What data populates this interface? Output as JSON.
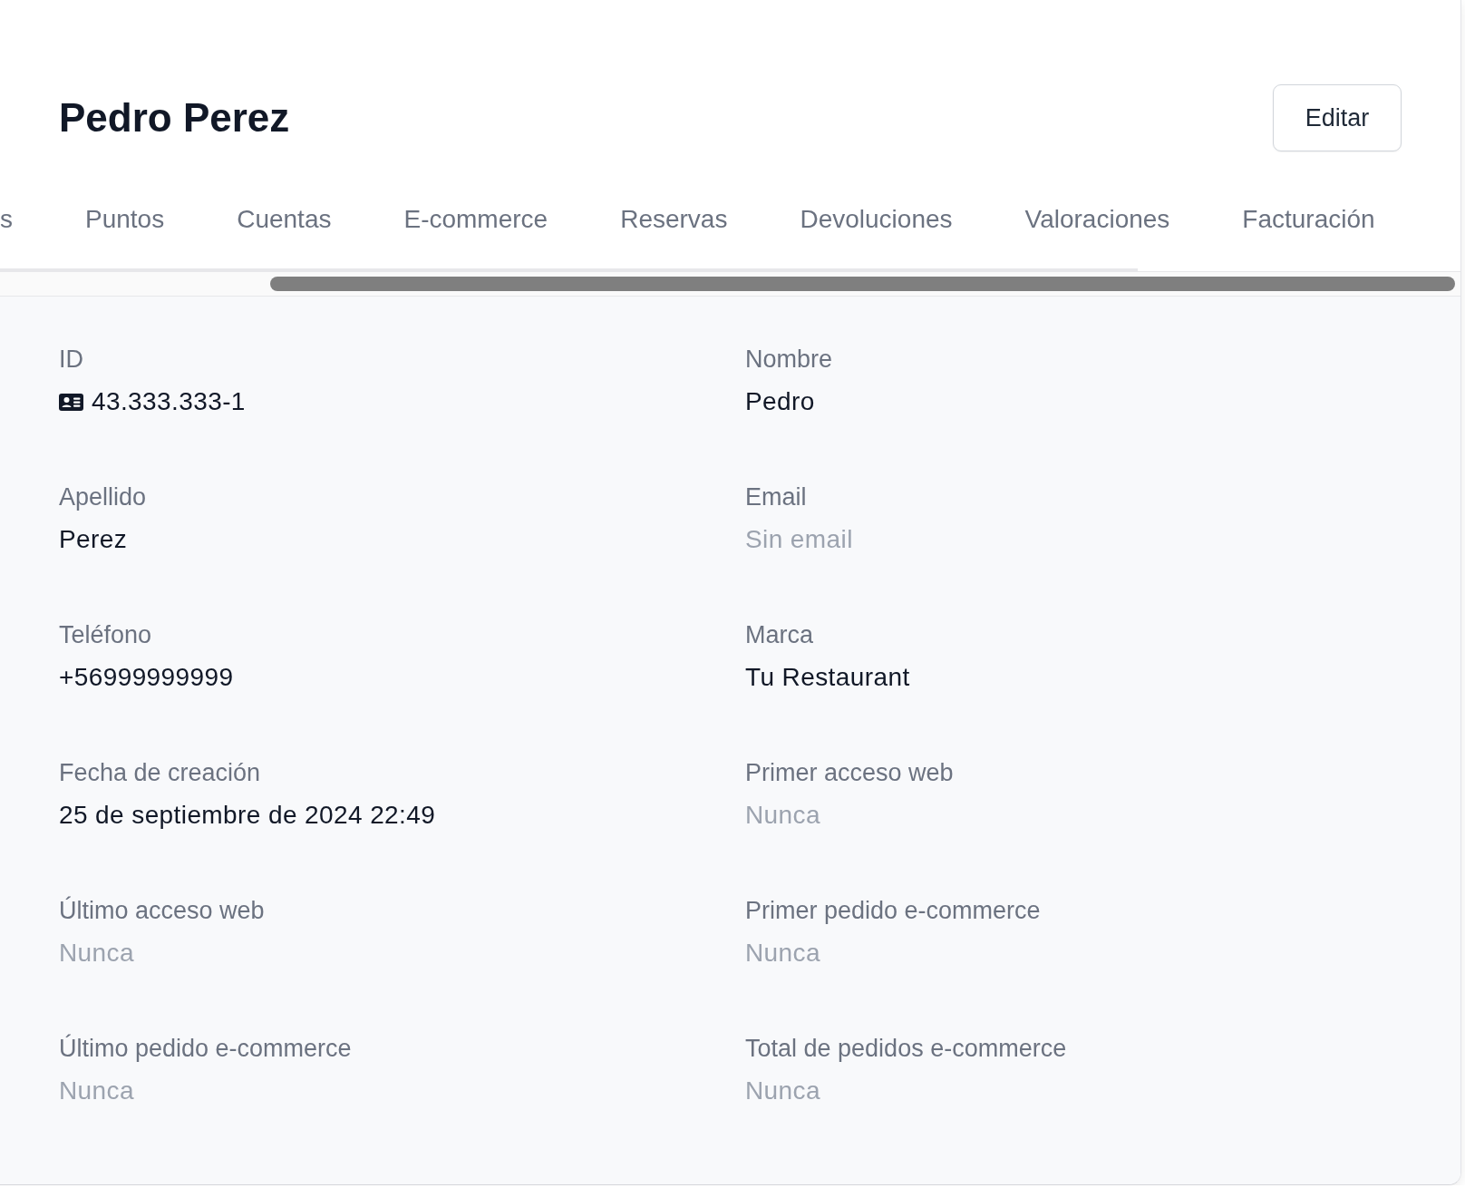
{
  "header": {
    "title": "Pedro Perez",
    "edit_button": "Editar"
  },
  "tabs": [
    {
      "label": "s",
      "selected": false
    },
    {
      "label": "Puntos",
      "selected": false
    },
    {
      "label": "Cuentas",
      "selected": false
    },
    {
      "label": "E-commerce",
      "selected": false
    },
    {
      "label": "Reservas",
      "selected": false
    },
    {
      "label": "Devoluciones",
      "selected": false
    },
    {
      "label": "Valoraciones",
      "selected": false
    },
    {
      "label": "Facturación",
      "selected": false
    }
  ],
  "fields": [
    {
      "label": "ID",
      "value": "43.333.333-1",
      "kind": "document",
      "empty": false
    },
    {
      "label": "Nombre",
      "value": "Pedro",
      "kind": "text",
      "empty": false
    },
    {
      "label": "Apellido",
      "value": "Perez",
      "kind": "text",
      "empty": false
    },
    {
      "label": "Email",
      "value": "Sin email",
      "kind": "text",
      "empty": true
    },
    {
      "label": "Teléfono",
      "value": "+56999999999",
      "kind": "text",
      "empty": false
    },
    {
      "label": "Marca",
      "value": "Tu Restaurant",
      "kind": "text",
      "empty": false
    },
    {
      "label": "Fecha de creación",
      "value": "25 de septiembre de 2024 22:49",
      "kind": "text",
      "empty": false
    },
    {
      "label": "Primer acceso web",
      "value": "Nunca",
      "kind": "text",
      "empty": true
    },
    {
      "label": "Último acceso web",
      "value": "Nunca",
      "kind": "text",
      "empty": true
    },
    {
      "label": "Primer pedido e-commerce",
      "value": "Nunca",
      "kind": "text",
      "empty": true
    },
    {
      "label": "Último pedido e-commerce",
      "value": "Nunca",
      "kind": "text",
      "empty": true
    },
    {
      "label": "Total de pedidos e-commerce",
      "value": "Nunca",
      "kind": "text",
      "empty": true
    }
  ]
}
